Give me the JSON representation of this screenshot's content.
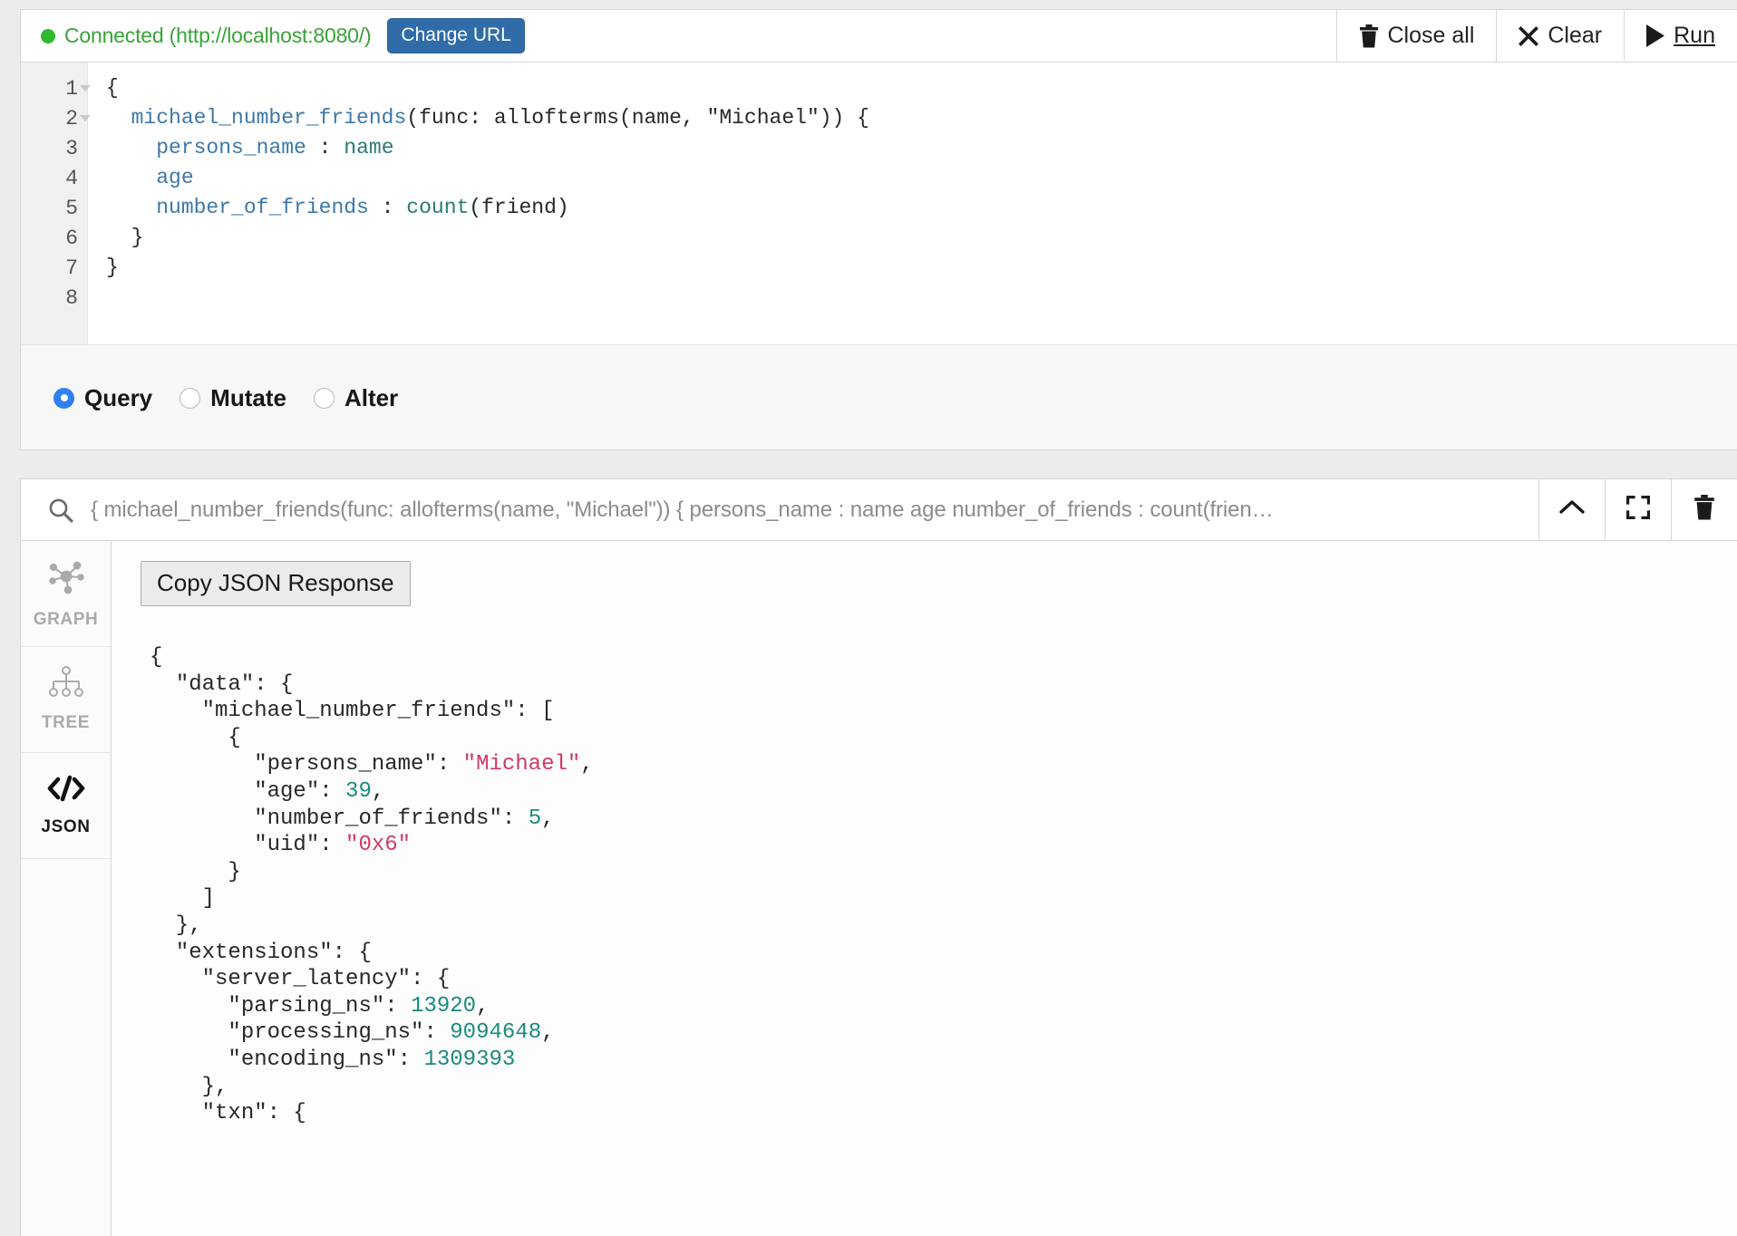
{
  "editor": {
    "connection": {
      "status_text": "Connected (http://localhost:8080/)",
      "dot_icon": "status-dot-icon",
      "dot_color": "#2eb82e",
      "text_color": "#37a437",
      "change_url_label": "Change URL"
    },
    "toolbar": [
      {
        "id": "close-all",
        "label": "Close all",
        "icon": "trash-icon"
      },
      {
        "id": "clear",
        "label": "Clear",
        "icon": "close-x-icon"
      },
      {
        "id": "run",
        "label": "Run",
        "icon": "play-icon"
      }
    ],
    "gutter_lines": [
      {
        "n": "1",
        "fold": true
      },
      {
        "n": "2",
        "fold": true
      },
      {
        "n": "3",
        "fold": false
      },
      {
        "n": "4",
        "fold": false
      },
      {
        "n": "5",
        "fold": false
      },
      {
        "n": "6",
        "fold": false
      },
      {
        "n": "7",
        "fold": false
      },
      {
        "n": "8",
        "fold": false
      }
    ],
    "code_lines": [
      [
        {
          "t": "{",
          "c": "tk-punc"
        }
      ],
      [
        {
          "t": "  ",
          "c": "tk-plain"
        },
        {
          "t": "michael_number_friends",
          "c": "tk-field"
        },
        {
          "t": "(func: allofterms(name, \"Michael\")) {",
          "c": "tk-plain"
        }
      ],
      [
        {
          "t": "    ",
          "c": "tk-plain"
        },
        {
          "t": "persons_name",
          "c": "tk-field"
        },
        {
          "t": " : ",
          "c": "tk-plain"
        },
        {
          "t": "name",
          "c": "tk-alias"
        }
      ],
      [
        {
          "t": "    ",
          "c": "tk-plain"
        },
        {
          "t": "age",
          "c": "tk-field"
        }
      ],
      [
        {
          "t": "    ",
          "c": "tk-plain"
        },
        {
          "t": "number_of_friends",
          "c": "tk-field"
        },
        {
          "t": " : ",
          "c": "tk-plain"
        },
        {
          "t": "count",
          "c": "tk-alias"
        },
        {
          "t": "(friend)",
          "c": "tk-plain"
        }
      ],
      [
        {
          "t": "  }",
          "c": "tk-punc"
        }
      ],
      [
        {
          "t": "}",
          "c": "tk-punc"
        }
      ],
      [
        {
          "t": "",
          "c": "tk-plain"
        }
      ]
    ],
    "modes": [
      {
        "label": "Query",
        "selected": true
      },
      {
        "label": "Mutate",
        "selected": false
      },
      {
        "label": "Alter",
        "selected": false
      }
    ]
  },
  "results": {
    "search": {
      "icon": "search-icon",
      "value": "{ michael_number_friends(func: allofterms(name, \"Michael\")) { persons_name : name age number_of_friends : count(frien…"
    },
    "header_buttons": [
      {
        "id": "collapse",
        "icon": "chevron-up-icon"
      },
      {
        "id": "fullscreen",
        "icon": "fullscreen-icon"
      },
      {
        "id": "delete",
        "icon": "trash-icon"
      }
    ],
    "side_tabs": [
      {
        "label": "GRAPH",
        "icon": "graph-nodes-icon",
        "active": false
      },
      {
        "label": "TREE",
        "icon": "tree-hierarchy-icon",
        "active": false
      },
      {
        "label": "JSON",
        "icon": "code-brackets-icon",
        "active": true
      }
    ],
    "copy_button_label": "Copy JSON Response",
    "json_lines": [
      [
        {
          "t": "{",
          "c": "j-punc"
        }
      ],
      [
        {
          "t": "  ",
          "c": "j-punc"
        },
        {
          "t": "\"data\"",
          "c": "j-key"
        },
        {
          "t": ": {",
          "c": "j-punc"
        }
      ],
      [
        {
          "t": "    ",
          "c": "j-punc"
        },
        {
          "t": "\"michael_number_friends\"",
          "c": "j-key"
        },
        {
          "t": ": [",
          "c": "j-punc"
        }
      ],
      [
        {
          "t": "      {",
          "c": "j-punc"
        }
      ],
      [
        {
          "t": "        ",
          "c": "j-punc"
        },
        {
          "t": "\"persons_name\"",
          "c": "j-key"
        },
        {
          "t": ": ",
          "c": "j-punc"
        },
        {
          "t": "\"Michael\"",
          "c": "j-str"
        },
        {
          "t": ",",
          "c": "j-punc"
        }
      ],
      [
        {
          "t": "        ",
          "c": "j-punc"
        },
        {
          "t": "\"age\"",
          "c": "j-key"
        },
        {
          "t": ": ",
          "c": "j-punc"
        },
        {
          "t": "39",
          "c": "j-num"
        },
        {
          "t": ",",
          "c": "j-punc"
        }
      ],
      [
        {
          "t": "        ",
          "c": "j-punc"
        },
        {
          "t": "\"number_of_friends\"",
          "c": "j-key"
        },
        {
          "t": ": ",
          "c": "j-punc"
        },
        {
          "t": "5",
          "c": "j-num"
        },
        {
          "t": ",",
          "c": "j-punc"
        }
      ],
      [
        {
          "t": "        ",
          "c": "j-punc"
        },
        {
          "t": "\"uid\"",
          "c": "j-key"
        },
        {
          "t": ": ",
          "c": "j-punc"
        },
        {
          "t": "\"0x6\"",
          "c": "j-str"
        }
      ],
      [
        {
          "t": "      }",
          "c": "j-punc"
        }
      ],
      [
        {
          "t": "    ]",
          "c": "j-punc"
        }
      ],
      [
        {
          "t": "  },",
          "c": "j-punc"
        }
      ],
      [
        {
          "t": "  ",
          "c": "j-punc"
        },
        {
          "t": "\"extensions\"",
          "c": "j-key"
        },
        {
          "t": ": {",
          "c": "j-punc"
        }
      ],
      [
        {
          "t": "    ",
          "c": "j-punc"
        },
        {
          "t": "\"server_latency\"",
          "c": "j-key"
        },
        {
          "t": ": {",
          "c": "j-punc"
        }
      ],
      [
        {
          "t": "      ",
          "c": "j-punc"
        },
        {
          "t": "\"parsing_ns\"",
          "c": "j-key"
        },
        {
          "t": ": ",
          "c": "j-punc"
        },
        {
          "t": "13920",
          "c": "j-num"
        },
        {
          "t": ",",
          "c": "j-punc"
        }
      ],
      [
        {
          "t": "      ",
          "c": "j-punc"
        },
        {
          "t": "\"processing_ns\"",
          "c": "j-key"
        },
        {
          "t": ": ",
          "c": "j-punc"
        },
        {
          "t": "9094648",
          "c": "j-num"
        },
        {
          "t": ",",
          "c": "j-punc"
        }
      ],
      [
        {
          "t": "      ",
          "c": "j-punc"
        },
        {
          "t": "\"encoding_ns\"",
          "c": "j-key"
        },
        {
          "t": ": ",
          "c": "j-punc"
        },
        {
          "t": "1309393",
          "c": "j-num"
        }
      ],
      [
        {
          "t": "    },",
          "c": "j-punc"
        }
      ],
      [
        {
          "t": "    ",
          "c": "j-punc"
        },
        {
          "t": "\"txn\"",
          "c": "j-key"
        },
        {
          "t": ": {",
          "c": "j-punc"
        }
      ]
    ]
  }
}
